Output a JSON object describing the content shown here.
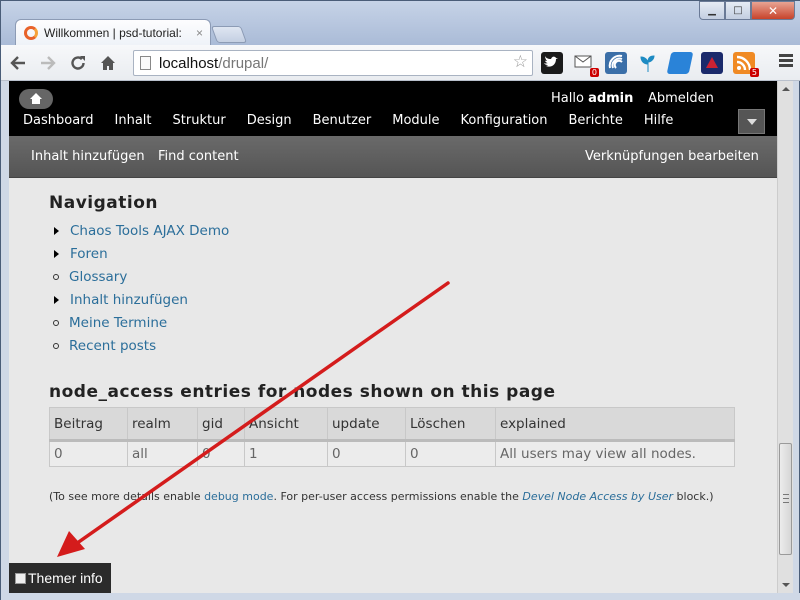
{
  "browser": {
    "tab_title": "Willkommen | psd-tutorial:",
    "tab_close": "×",
    "url_host": "localhost",
    "url_path": "/drupal/",
    "window_controls": {
      "minimize": "▁",
      "maximize": "□",
      "close": "✕"
    },
    "nav_icons": [
      "back-icon",
      "forward-icon",
      "reload-icon",
      "home-icon"
    ],
    "extension_badges": {
      "mail": "0",
      "rss": "5"
    }
  },
  "drupal_toolbar": {
    "greeting": "Hallo",
    "username": "admin",
    "logout": "Abmelden",
    "menu": [
      "Dashboard",
      "Inhalt",
      "Struktur",
      "Design",
      "Benutzer",
      "Module",
      "Konfiguration",
      "Berichte",
      "Hilfe"
    ]
  },
  "shortcuts": {
    "add_content": "Inhalt hinzufügen",
    "find_content": "Find content",
    "edit_shortcuts": "Verknüpfungen bearbeiten"
  },
  "navigation": {
    "title": "Navigation",
    "items": [
      {
        "label": "Chaos Tools AJAX Demo",
        "type": "collapsed"
      },
      {
        "label": "Foren",
        "type": "collapsed"
      },
      {
        "label": "Glossary",
        "type": "leaf"
      },
      {
        "label": "Inhalt hinzufügen",
        "type": "collapsed"
      },
      {
        "label": "Meine Termine",
        "type": "leaf"
      },
      {
        "label": "Recent posts",
        "type": "leaf"
      }
    ]
  },
  "node_access": {
    "title": "node_access entries for nodes shown on this page",
    "columns": [
      "Beitrag",
      "realm",
      "gid",
      "Ansicht",
      "update",
      "Löschen",
      "explained"
    ],
    "rows": [
      [
        "0",
        "all",
        "0",
        "1",
        "0",
        "0",
        "All users may view all nodes."
      ]
    ],
    "note_prefix": "(To see more details enable ",
    "note_link1": "debug mode",
    "note_middle": ". For per-user access permissions enable the ",
    "note_link2": "Devel Node Access by User",
    "note_suffix": " block.)"
  },
  "themer": {
    "label": "Themer info"
  },
  "colors": {
    "link": "#2b6e9a",
    "toolbar_bg": "#000000",
    "annotation_arrow": "#d41c1c"
  }
}
